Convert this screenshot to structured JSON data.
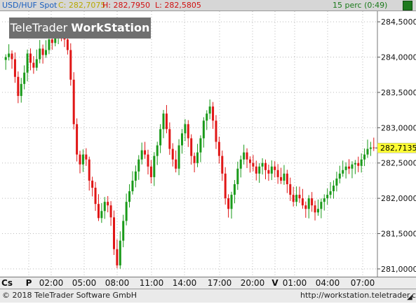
{
  "header": {
    "symbol": "USD/HUF Spot",
    "close": "C: 282,7075",
    "high": "H: 282,7950",
    "low": "L: 282,5805",
    "interval": "15 perc (0:49)"
  },
  "logo": {
    "light": "TeleTrader ",
    "bold": "WorkStation"
  },
  "price_tag": "282,7135",
  "x_axis_labels": [
    "Cs",
    "P",
    "02:00",
    "05:00",
    "08:00",
    "11:00",
    "14:00",
    "17:00",
    "20:00",
    "V",
    "01:00",
    "04:00",
    "07:00"
  ],
  "footer": {
    "left": "© 2018 TeleTrader Software GmbH",
    "right": "http://workstation.teletrader.com"
  },
  "colors": {
    "up": "#1a9a1a",
    "down": "#e01616",
    "tag": "#ffff33",
    "grid": "#bbbbbb"
  },
  "chart_data": {
    "type": "candlestick",
    "ylim": [
      280.9,
      284.65
    ],
    "y_ticks": [
      "284,5000",
      "284,0000",
      "283,5000",
      "283,0000",
      "282,5000",
      "282,0000",
      "281,5000",
      "281,0000"
    ],
    "y_tick_values": [
      284.5,
      284.0,
      283.5,
      283.0,
      282.5,
      282.0,
      281.5,
      281.0
    ],
    "x_tick_labels": [
      "02:00",
      "05:00",
      "08:00",
      "11:00",
      "14:00",
      "17:00",
      "20:00",
      "01:00",
      "04:00",
      "07:00"
    ],
    "day_separators": [
      "P",
      "V"
    ],
    "last_price": 282.7135,
    "close_series": [
      284.0,
      284.05,
      283.97,
      283.72,
      283.45,
      283.62,
      283.78,
      284.05,
      283.92,
      283.85,
      283.97,
      284.12,
      284.03,
      284.1,
      284.25,
      284.2,
      284.28,
      284.32,
      284.3,
      284.25,
      284.1,
      283.68,
      283.05,
      282.62,
      282.48,
      282.62,
      282.55,
      282.25,
      282.15,
      281.92,
      281.72,
      281.82,
      281.95,
      281.9,
      281.73,
      281.28,
      281.05,
      281.4,
      281.68,
      281.95,
      282.1,
      282.25,
      282.38,
      282.55,
      282.68,
      282.62,
      282.45,
      282.3,
      282.6,
      282.75,
      282.98,
      283.2,
      282.98,
      282.7,
      282.55,
      282.42,
      282.75,
      282.92,
      283.05,
      282.85,
      282.6,
      282.5,
      282.65,
      282.85,
      283.1,
      283.2,
      283.3,
      283.1,
      282.8,
      282.6,
      282.35,
      282.0,
      281.85,
      282.05,
      282.2,
      282.42,
      282.55,
      282.65,
      282.55,
      282.5,
      282.45,
      282.35,
      282.45,
      282.5,
      282.4,
      282.35,
      282.45,
      282.4,
      282.3,
      282.25,
      282.35,
      282.2,
      282.05,
      281.95,
      282.05,
      282.0,
      281.9,
      281.85,
      282.0,
      281.9,
      281.8,
      281.85,
      281.95,
      282.0,
      282.05,
      282.1,
      282.18,
      282.28,
      282.35,
      282.4,
      282.45,
      282.42,
      282.48,
      282.5,
      282.46,
      282.55,
      282.62,
      282.7,
      282.72,
      282.71
    ],
    "open_series": [
      283.96,
      284.0,
      284.05,
      283.97,
      283.72,
      283.45,
      283.62,
      283.78,
      284.05,
      283.92,
      283.85,
      283.97,
      284.12,
      284.03,
      284.1,
      284.25,
      284.2,
      284.28,
      284.32,
      284.3,
      284.25,
      284.1,
      283.68,
      283.05,
      282.62,
      282.48,
      282.62,
      282.55,
      282.25,
      282.15,
      281.92,
      281.72,
      281.82,
      281.95,
      281.9,
      281.73,
      281.28,
      281.05,
      281.4,
      281.68,
      281.95,
      282.1,
      282.25,
      282.38,
      282.55,
      282.68,
      282.62,
      282.45,
      282.3,
      282.6,
      282.75,
      282.98,
      283.2,
      282.98,
      282.7,
      282.55,
      282.42,
      282.75,
      282.92,
      283.05,
      282.85,
      282.6,
      282.5,
      282.65,
      282.85,
      283.1,
      283.2,
      283.3,
      283.1,
      282.8,
      282.6,
      282.35,
      282.0,
      281.85,
      282.05,
      282.2,
      282.42,
      282.55,
      282.65,
      282.55,
      282.5,
      282.45,
      282.35,
      282.45,
      282.5,
      282.4,
      282.35,
      282.45,
      282.4,
      282.3,
      282.25,
      282.35,
      282.2,
      282.05,
      281.95,
      282.05,
      282.0,
      281.9,
      281.85,
      282.0,
      281.9,
      281.8,
      281.85,
      281.95,
      282.0,
      282.05,
      282.1,
      282.18,
      282.28,
      282.35,
      282.4,
      282.45,
      282.42,
      282.48,
      282.5,
      282.46,
      282.55,
      282.62,
      282.7,
      282.72
    ]
  }
}
